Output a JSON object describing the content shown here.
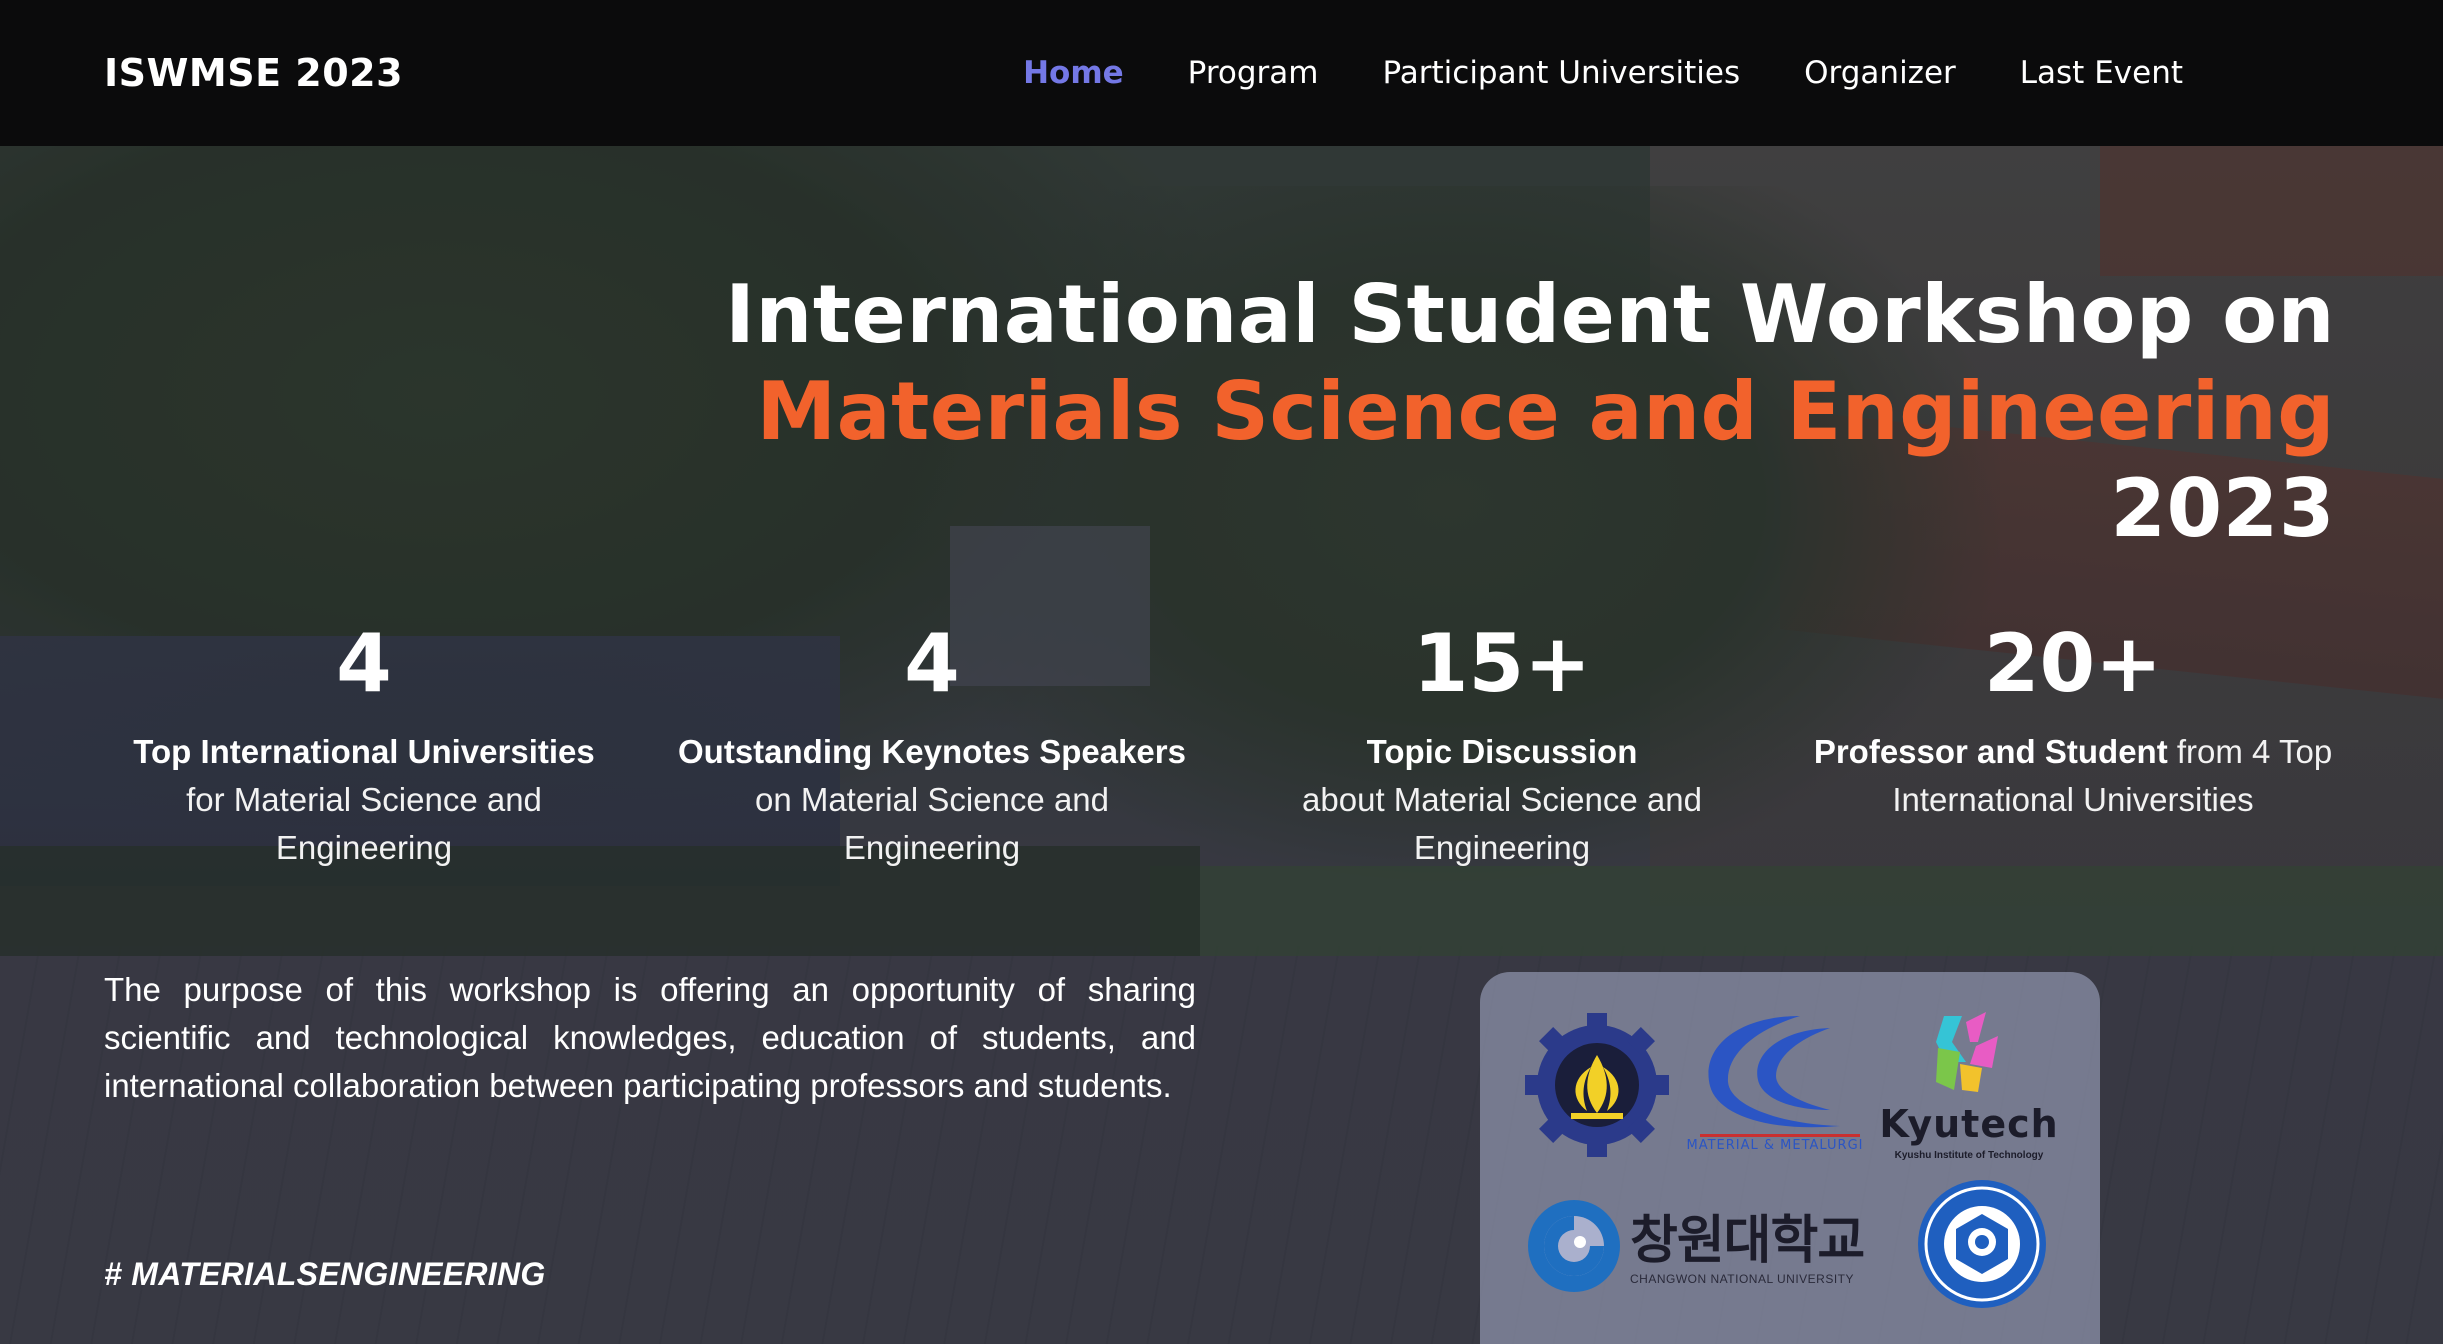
{
  "nav": {
    "brand": "ISWMSE 2023",
    "links": [
      {
        "label": "Home",
        "active": true
      },
      {
        "label": "Program",
        "active": false
      },
      {
        "label": "Participant Universities",
        "active": false
      },
      {
        "label": "Organizer",
        "active": false
      },
      {
        "label": "Last Event",
        "active": false
      }
    ],
    "active_color": "#7478e6"
  },
  "hero": {
    "title_line1": "International Student Workshop on",
    "title_line2": "Materials Science and Engineering",
    "title_line3": "2023",
    "accent_color": "#f2622c"
  },
  "stats": [
    {
      "number": "4",
      "strong": "Top International Universities",
      "rest": "for Material Science and Engineering"
    },
    {
      "number": "4",
      "strong": "Outstanding Keynotes Speakers",
      "rest": "on Material Science and Engineering"
    },
    {
      "number": "15+",
      "strong": "Topic Discussion",
      "rest": "about Material Science and Engineering"
    },
    {
      "number": "20+",
      "strong": "Professor and Student",
      "rest": "from 4 Top International Universities"
    }
  ],
  "description": "The purpose of this workshop is offering an opportunity of sharing scientific and technological knowledges, education of students, and international collaboration between participating professors and students.",
  "hashtag": "# MATERIALSENGINEERING",
  "logos": {
    "its_icon": "its-logo-icon",
    "mm_caption": "MATERIAL & METALURGI",
    "kyutech_name": "Kyutech",
    "kyutech_sub": "Kyushu Institute of Technology",
    "cwnu_korean": "창원대학교",
    "cwnu_english": "CHANGWON NATIONAL UNIVERSITY",
    "ntust_icon": "ntust-logo-icon"
  }
}
